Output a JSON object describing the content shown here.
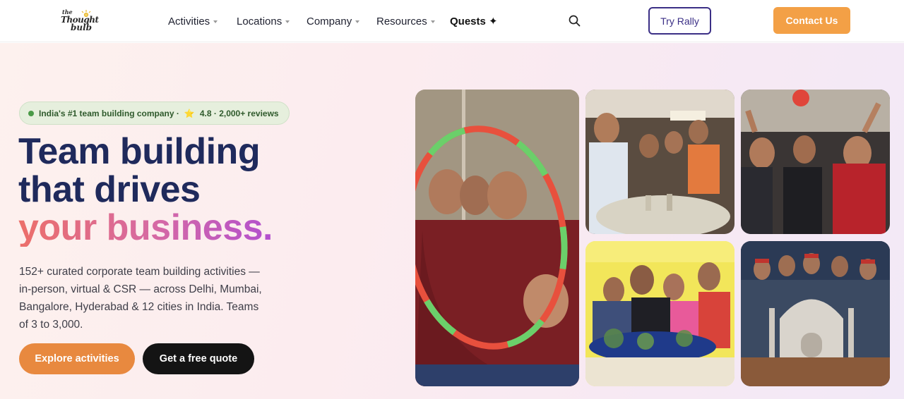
{
  "brand": {
    "logo_line1": "the",
    "logo_line2": "Thought",
    "logo_line3": "bulb"
  },
  "nav": {
    "items": [
      {
        "label": "Activities",
        "has_dropdown": true
      },
      {
        "label": "Locations",
        "has_dropdown": true
      },
      {
        "label": "Company",
        "has_dropdown": true
      },
      {
        "label": "Resources",
        "has_dropdown": true
      },
      {
        "label": "Quests ✦",
        "has_dropdown": false
      }
    ],
    "search_icon": "search-icon",
    "try_label": "Try Rally",
    "contact_label": "Contact Us"
  },
  "hero": {
    "badge": {
      "text": "India's #1 team building company ·",
      "star": "⭐",
      "rating": "4.8 · 2,000+ reviews"
    },
    "headline_line1": "Team building",
    "headline_line2": "that drives",
    "headline_line3": "your business.",
    "description": "152+ curated corporate team building activities — in-person, virtual & CSR — across Delhi, Mumbai, Bangalore, Hyderabad & 12 cities in India. Teams of 3 to 3,000.",
    "cta_primary": "Explore activities",
    "cta_secondary": "Get a free quote"
  },
  "colors": {
    "brand_navy": "#1f2a5c",
    "accent_orange": "#f3a046",
    "cta_orange": "#e8893f",
    "try_border": "#3b2f86",
    "badge_green": "#2f5a2c",
    "gradient_start": "#ec6f6a",
    "gradient_end": "#b24fcf"
  }
}
